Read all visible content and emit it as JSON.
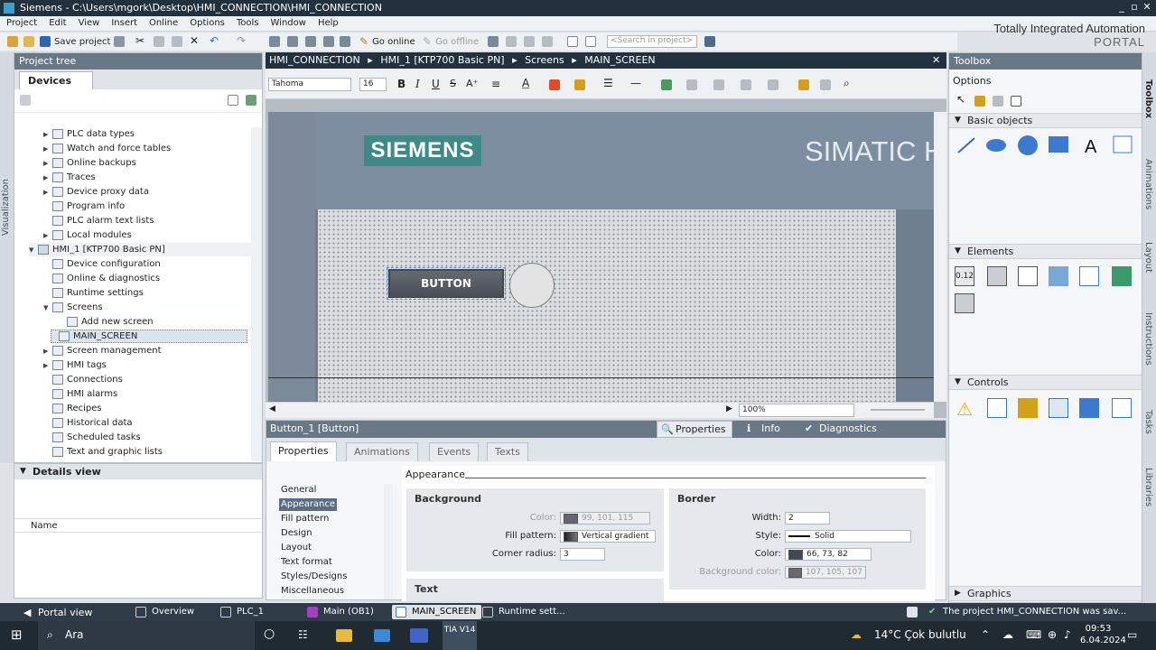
{
  "window": {
    "title": "Siemens  -  C:\\Users\\mgork\\Desktop\\HMI_CONNECTION\\HMI_CONNECTION",
    "min": "_",
    "max": "▫",
    "close": "✕"
  },
  "menu": [
    "Project",
    "Edit",
    "View",
    "Insert",
    "Online",
    "Options",
    "Tools",
    "Window",
    "Help"
  ],
  "brand": {
    "line1": "Totally Integrated Automation",
    "line2": "PORTAL"
  },
  "toolbar": {
    "save_label": "Save project",
    "go_online": "Go online",
    "go_offline": "Go offline",
    "search_placeholder": "<Search in project>"
  },
  "left": {
    "vertical_tab": "Visualization",
    "project_tree_title": "Project tree",
    "devices_tab": "Devices",
    "tree": [
      {
        "label": "PLC data types",
        "arrow": "▶"
      },
      {
        "label": "Watch and force tables",
        "arrow": "▶"
      },
      {
        "label": "Online backups",
        "arrow": "▶"
      },
      {
        "label": "Traces",
        "arrow": "▶"
      },
      {
        "label": "Device proxy data",
        "arrow": "▶"
      },
      {
        "label": "Program info",
        "arrow": ""
      },
      {
        "label": "PLC alarm text lists",
        "arrow": ""
      },
      {
        "label": "Local modules",
        "arrow": "▶"
      },
      {
        "label": "HMI_1 [KTP700 Basic PN]",
        "arrow": "▼"
      },
      {
        "label": "Device configuration",
        "arrow": ""
      },
      {
        "label": "Online & diagnostics",
        "arrow": ""
      },
      {
        "label": "Runtime settings",
        "arrow": ""
      },
      {
        "label": "Screens",
        "arrow": "▼"
      },
      {
        "label": "Add new screen",
        "arrow": ""
      },
      {
        "label": "MAIN_SCREEN",
        "arrow": ""
      },
      {
        "label": "Screen management",
        "arrow": "▶"
      },
      {
        "label": "HMI tags",
        "arrow": "▶"
      },
      {
        "label": "Connections",
        "arrow": ""
      },
      {
        "label": "HMI alarms",
        "arrow": ""
      },
      {
        "label": "Recipes",
        "arrow": ""
      },
      {
        "label": "Historical data",
        "arrow": ""
      },
      {
        "label": "Scheduled tasks",
        "arrow": ""
      },
      {
        "label": "Text and graphic lists",
        "arrow": ""
      }
    ],
    "details_title": "Details view",
    "details_col": "Name"
  },
  "editor": {
    "breadcrumb": [
      "HMI_CONNECTION",
      "HMI_1 [KTP700 Basic PN]",
      "Screens",
      "MAIN_SCREEN"
    ],
    "font": "Tahoma",
    "font_size": "16",
    "logo": "SIEMENS",
    "simatic": "SIMATIC H",
    "button_label": "BUTTON",
    "zoom": "100%"
  },
  "inspector": {
    "title": "Button_1 [Button]",
    "right_tabs": [
      "Properties",
      "Info",
      "Diagnostics"
    ],
    "tabs": [
      "Properties",
      "Animations",
      "Events",
      "Texts"
    ],
    "nav": [
      "General",
      "Appearance",
      "Fill pattern",
      "Design",
      "Layout",
      "Text format",
      "Styles/Designs",
      "Miscellaneous"
    ],
    "section": "Appearance",
    "background": {
      "title": "Background",
      "color_label": "Color:",
      "color_value": "99, 101, 115",
      "fill_label": "Fill pattern:",
      "fill_value": "Vertical gradient",
      "radius_label": "Corner radius:",
      "radius_value": "3"
    },
    "border": {
      "title": "Border",
      "width_label": "Width:",
      "width_value": "2",
      "style_label": "Style:",
      "style_value": "Solid",
      "color_label": "Color:",
      "color_value": "66, 73, 82",
      "bg_label": "Background color:",
      "bg_value": "107, 105, 107"
    },
    "text_group": "Text"
  },
  "toolbox": {
    "title": "Toolbox",
    "options": "Options",
    "sections": [
      "Basic objects",
      "Elements",
      "Controls",
      "Graphics"
    ]
  },
  "sidetabs": [
    "Toolbox",
    "Animations",
    "Layout",
    "Instructions",
    "Tasks",
    "Libraries"
  ],
  "portal": {
    "view": "Portal view",
    "items": [
      "Overview",
      "PLC_1",
      "Main (OB1)",
      "MAIN_SCREEN",
      "Runtime sett..."
    ],
    "status": "The project HMI_CONNECTION was sav..."
  },
  "taskbar": {
    "search": "Ara",
    "weather": "14°C  Çok bulutlu",
    "time": "09:53",
    "date": "6.04.2024",
    "tia": "TIA V14"
  },
  "colors": {
    "title": "#22313d",
    "panel": "#6a7885",
    "button_bg": "#636573",
    "border": "#424952"
  }
}
